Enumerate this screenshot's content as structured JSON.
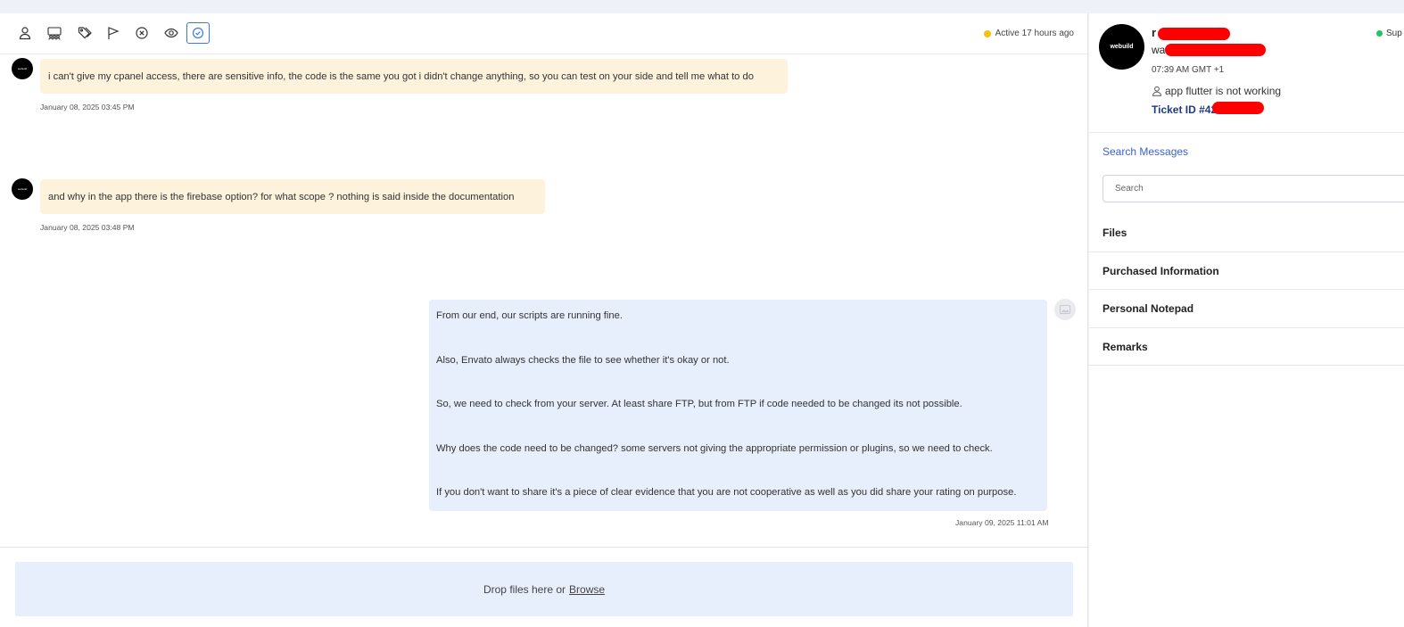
{
  "toolbar": {
    "icons": [
      "user-icon",
      "group-icon",
      "tags-icon",
      "flag-icon",
      "close-circle-icon",
      "eye-icon",
      "check-circle-icon"
    ],
    "status_text": "Active 17 hours ago",
    "status_color": "#f4c20d"
  },
  "messages": [
    {
      "direction": "incoming",
      "avatar_label": "webuild",
      "text": "i can't give my cpanel access, there are sensitive info, the code is the same you got i didn't change anything, so you can test on your side and tell me what to do",
      "timestamp": "January 08, 2025 03:45 PM"
    },
    {
      "direction": "incoming",
      "avatar_label": "webuild",
      "text": "and why in the app there is the firebase option? for what scope ? nothing is said inside the documentation",
      "timestamp": "January 08, 2025 03:48 PM"
    },
    {
      "direction": "outgoing",
      "paragraphs": [
        "From our end, our scripts are running fine.",
        "Also, Envato always checks the file to see whether it's okay or not.",
        "So, we need to check from your server. At least share FTP, but from FTP if code needed to be changed its not possible.",
        "Why does the code need to be changed? some servers not giving the appropriate permission or plugins, so we need to check.",
        "If you don't want to share it's a piece of clear evidence that you are not cooperative as well as you did share your rating on purpose."
      ],
      "timestamp": "January 09, 2025 11:01 AM"
    }
  ],
  "dropzone": {
    "text": "Drop files here or",
    "browse_label": "Browse"
  },
  "sidebar": {
    "avatar_label": "webuild",
    "name_visible": "r",
    "email_visible": "wa",
    "local_time": "07:39 AM GMT +1",
    "subject": "app flutter is not working",
    "ticket_label": "Ticket ID #42",
    "online_text": "Sup",
    "online_color": "#22c55e",
    "search_title": "Search Messages",
    "search_placeholder": "Search",
    "sections": [
      "Files",
      "Purchased Information",
      "Personal Notepad",
      "Remarks"
    ]
  }
}
